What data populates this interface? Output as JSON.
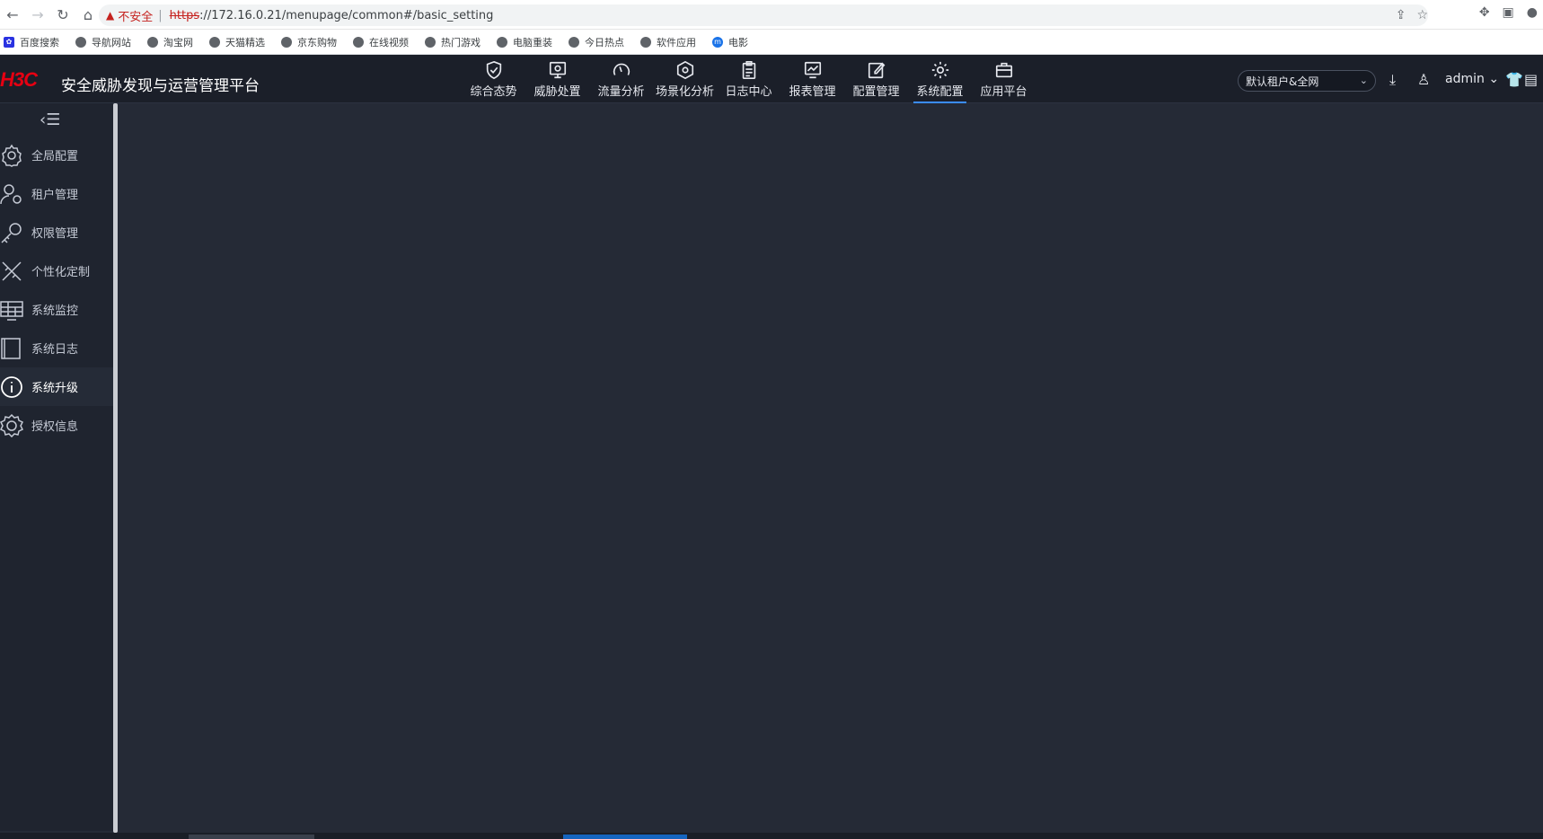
{
  "browser": {
    "warning_text": "不安全",
    "url_scheme": "https",
    "url_rest": "://172.16.0.21/menupage/common#/basic_setting",
    "bookmarks": [
      {
        "label": "百度搜索",
        "icon": "baidu-icon"
      },
      {
        "label": "导航网站",
        "icon": "globe-icon"
      },
      {
        "label": "淘宝网",
        "icon": "globe-icon"
      },
      {
        "label": "天猫精选",
        "icon": "globe-icon"
      },
      {
        "label": "京东购物",
        "icon": "globe-icon"
      },
      {
        "label": "在线视频",
        "icon": "globe-icon"
      },
      {
        "label": "热门游戏",
        "icon": "globe-icon"
      },
      {
        "label": "电脑重装",
        "icon": "globe-icon"
      },
      {
        "label": "今日热点",
        "icon": "globe-icon"
      },
      {
        "label": "软件应用",
        "icon": "globe-icon"
      },
      {
        "label": "电影",
        "icon": "m-icon"
      }
    ]
  },
  "app": {
    "logo_text": "H3C",
    "title": "安全威胁发现与运营管理平台",
    "nav": [
      {
        "label": "综合态势",
        "icon": "shield-check-icon",
        "active": false
      },
      {
        "label": "威胁处置",
        "icon": "monitor-alert-icon",
        "active": false
      },
      {
        "label": "流量分析",
        "icon": "gauge-icon",
        "active": false
      },
      {
        "label": "场景化分析",
        "icon": "hexagon-icon",
        "active": false
      },
      {
        "label": "日志中心",
        "icon": "clipboard-icon",
        "active": false
      },
      {
        "label": "报表管理",
        "icon": "chart-monitor-icon",
        "active": false
      },
      {
        "label": "配置管理",
        "icon": "edit-icon",
        "active": false
      },
      {
        "label": "系统配置",
        "icon": "gear-icon",
        "active": true
      },
      {
        "label": "应用平台",
        "icon": "briefcase-icon",
        "active": false
      }
    ],
    "tenant_select": "默认租户&全网",
    "user": "admin"
  },
  "sidebar": {
    "items": [
      {
        "label": "全局配置",
        "icon": "gear-icon",
        "active": false
      },
      {
        "label": "租户管理",
        "icon": "user-gear-icon",
        "active": false
      },
      {
        "label": "权限管理",
        "icon": "key-icon",
        "active": false
      },
      {
        "label": "个性化定制",
        "icon": "tools-icon",
        "active": false
      },
      {
        "label": "系统监控",
        "icon": "monitor-grid-icon",
        "active": false
      },
      {
        "label": "系统日志",
        "icon": "book-icon",
        "active": false
      },
      {
        "label": "系统升级",
        "icon": "info-icon",
        "active": true
      },
      {
        "label": "授权信息",
        "icon": "badge-icon",
        "active": false
      }
    ]
  },
  "colors": {
    "header_bg": "#1b1f29",
    "content_bg": "#252a36",
    "sidebar_bg": "#1f242f",
    "accent": "#3b8cff",
    "logo_red": "#e60012"
  }
}
